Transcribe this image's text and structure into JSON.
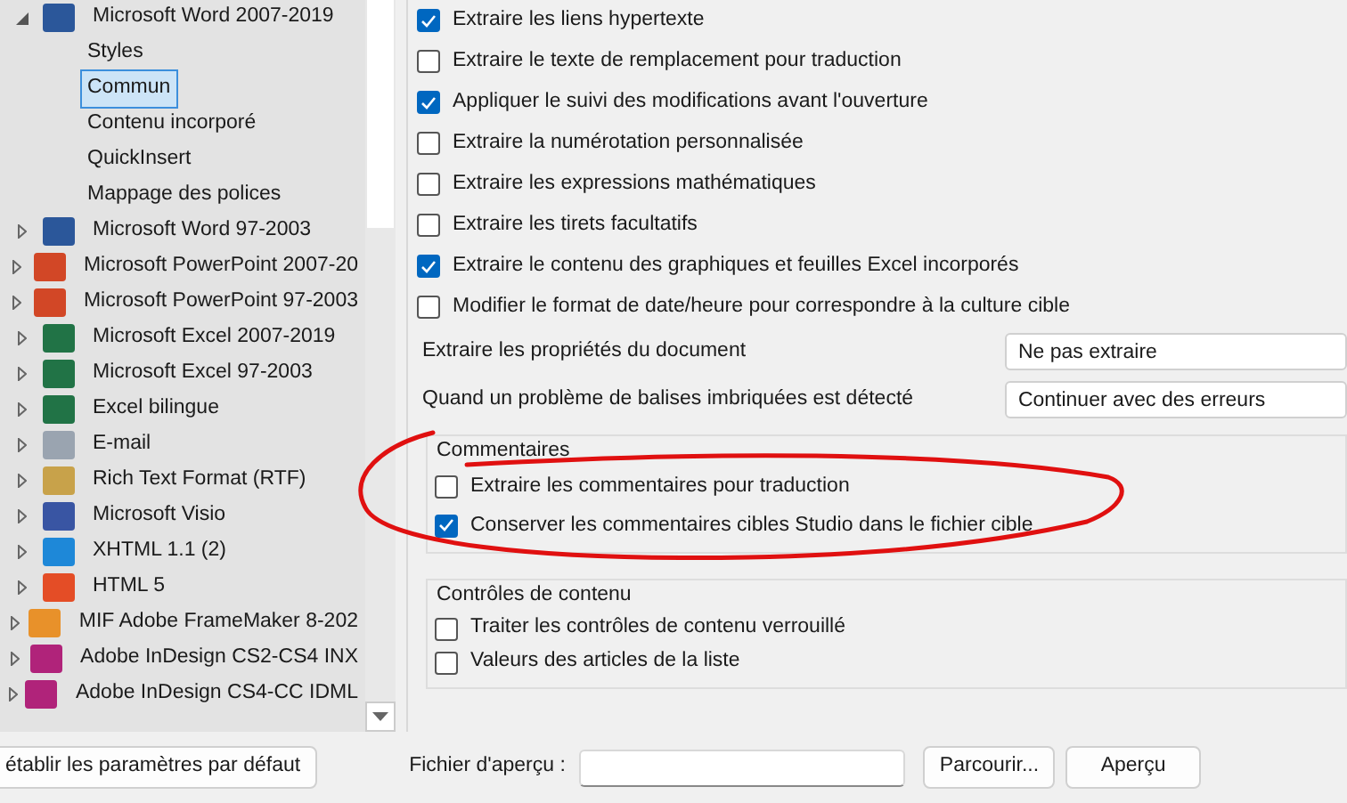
{
  "tree": [
    {
      "label": "Microsoft Word 2007-2019",
      "color": "#2b579a",
      "expanded": true,
      "children": [
        {
          "label": "Styles",
          "selected": false
        },
        {
          "label": "Commun",
          "selected": true
        },
        {
          "label": "Contenu incorporé",
          "selected": false
        },
        {
          "label": "QuickInsert",
          "selected": false
        },
        {
          "label": "Mappage des polices",
          "selected": false
        }
      ]
    },
    {
      "label": "Microsoft Word 97-2003",
      "color": "#2b579a",
      "expanded": false
    },
    {
      "label": "Microsoft PowerPoint 2007-20",
      "color": "#d24726",
      "expanded": false
    },
    {
      "label": "Microsoft PowerPoint 97-2003",
      "color": "#d24726",
      "expanded": false
    },
    {
      "label": "Microsoft Excel 2007-2019",
      "color": "#217346",
      "expanded": false
    },
    {
      "label": "Microsoft Excel 97-2003",
      "color": "#217346",
      "expanded": false
    },
    {
      "label": "Excel bilingue",
      "color": "#217346",
      "expanded": false
    },
    {
      "label": "E-mail",
      "color": "#9aa4b0",
      "expanded": false
    },
    {
      "label": "Rich Text Format (RTF)",
      "color": "#c8a24a",
      "expanded": false
    },
    {
      "label": "Microsoft Visio",
      "color": "#3955a3",
      "expanded": false
    },
    {
      "label": "XHTML 1.1 (2)",
      "color": "#1e88d8",
      "expanded": false
    },
    {
      "label": "HTML 5",
      "color": "#e44d26",
      "expanded": false
    },
    {
      "label": "MIF Adobe FrameMaker 8-202",
      "color": "#e8912a",
      "expanded": false
    },
    {
      "label": "Adobe InDesign CS2-CS4 INX",
      "color": "#b0237a",
      "expanded": false
    },
    {
      "label": "Adobe InDesign CS4-CC IDML",
      "color": "#b0237a",
      "expanded": false
    }
  ],
  "options": [
    {
      "label": "Extraire les liens hypertexte",
      "checked": true
    },
    {
      "label": "Extraire le texte de remplacement pour traduction",
      "checked": false
    },
    {
      "label": "Appliquer le suivi des modifications avant l'ouverture",
      "checked": true
    },
    {
      "label": "Extraire la numérotation personnalisée",
      "checked": false
    },
    {
      "label": "Extraire les expressions mathématiques",
      "checked": false
    },
    {
      "label": "Extraire les tirets facultatifs",
      "checked": false
    },
    {
      "label": "Extraire le contenu des graphiques et feuilles Excel incorporés",
      "checked": true
    },
    {
      "label": "Modifier le format de date/heure pour correspondre à la culture cible",
      "checked": false
    }
  ],
  "properties": [
    {
      "label": "Extraire les propriétés du document",
      "value": "Ne pas extraire"
    },
    {
      "label": "Quand un problème de balises imbriquées est détecté",
      "value": "Continuer avec des erreurs"
    }
  ],
  "groups": [
    {
      "title": "Commentaires",
      "items": [
        {
          "label": "Extraire les commentaires pour traduction",
          "checked": false
        },
        {
          "label": "Conserver les commentaires cibles Studio dans le fichier cible",
          "checked": true
        }
      ]
    },
    {
      "title": "Contrôles de contenu",
      "items": [
        {
          "label": "Traiter les contrôles de contenu verrouillé",
          "checked": false
        },
        {
          "label": "Valeurs des articles de la liste",
          "checked": false
        }
      ]
    }
  ],
  "footer": {
    "reset_button": "établir les paramètres par défaut",
    "preview_label": "Fichier d'aperçu :",
    "browse_button": "Parcourir...",
    "preview_button": "Aperçu"
  }
}
